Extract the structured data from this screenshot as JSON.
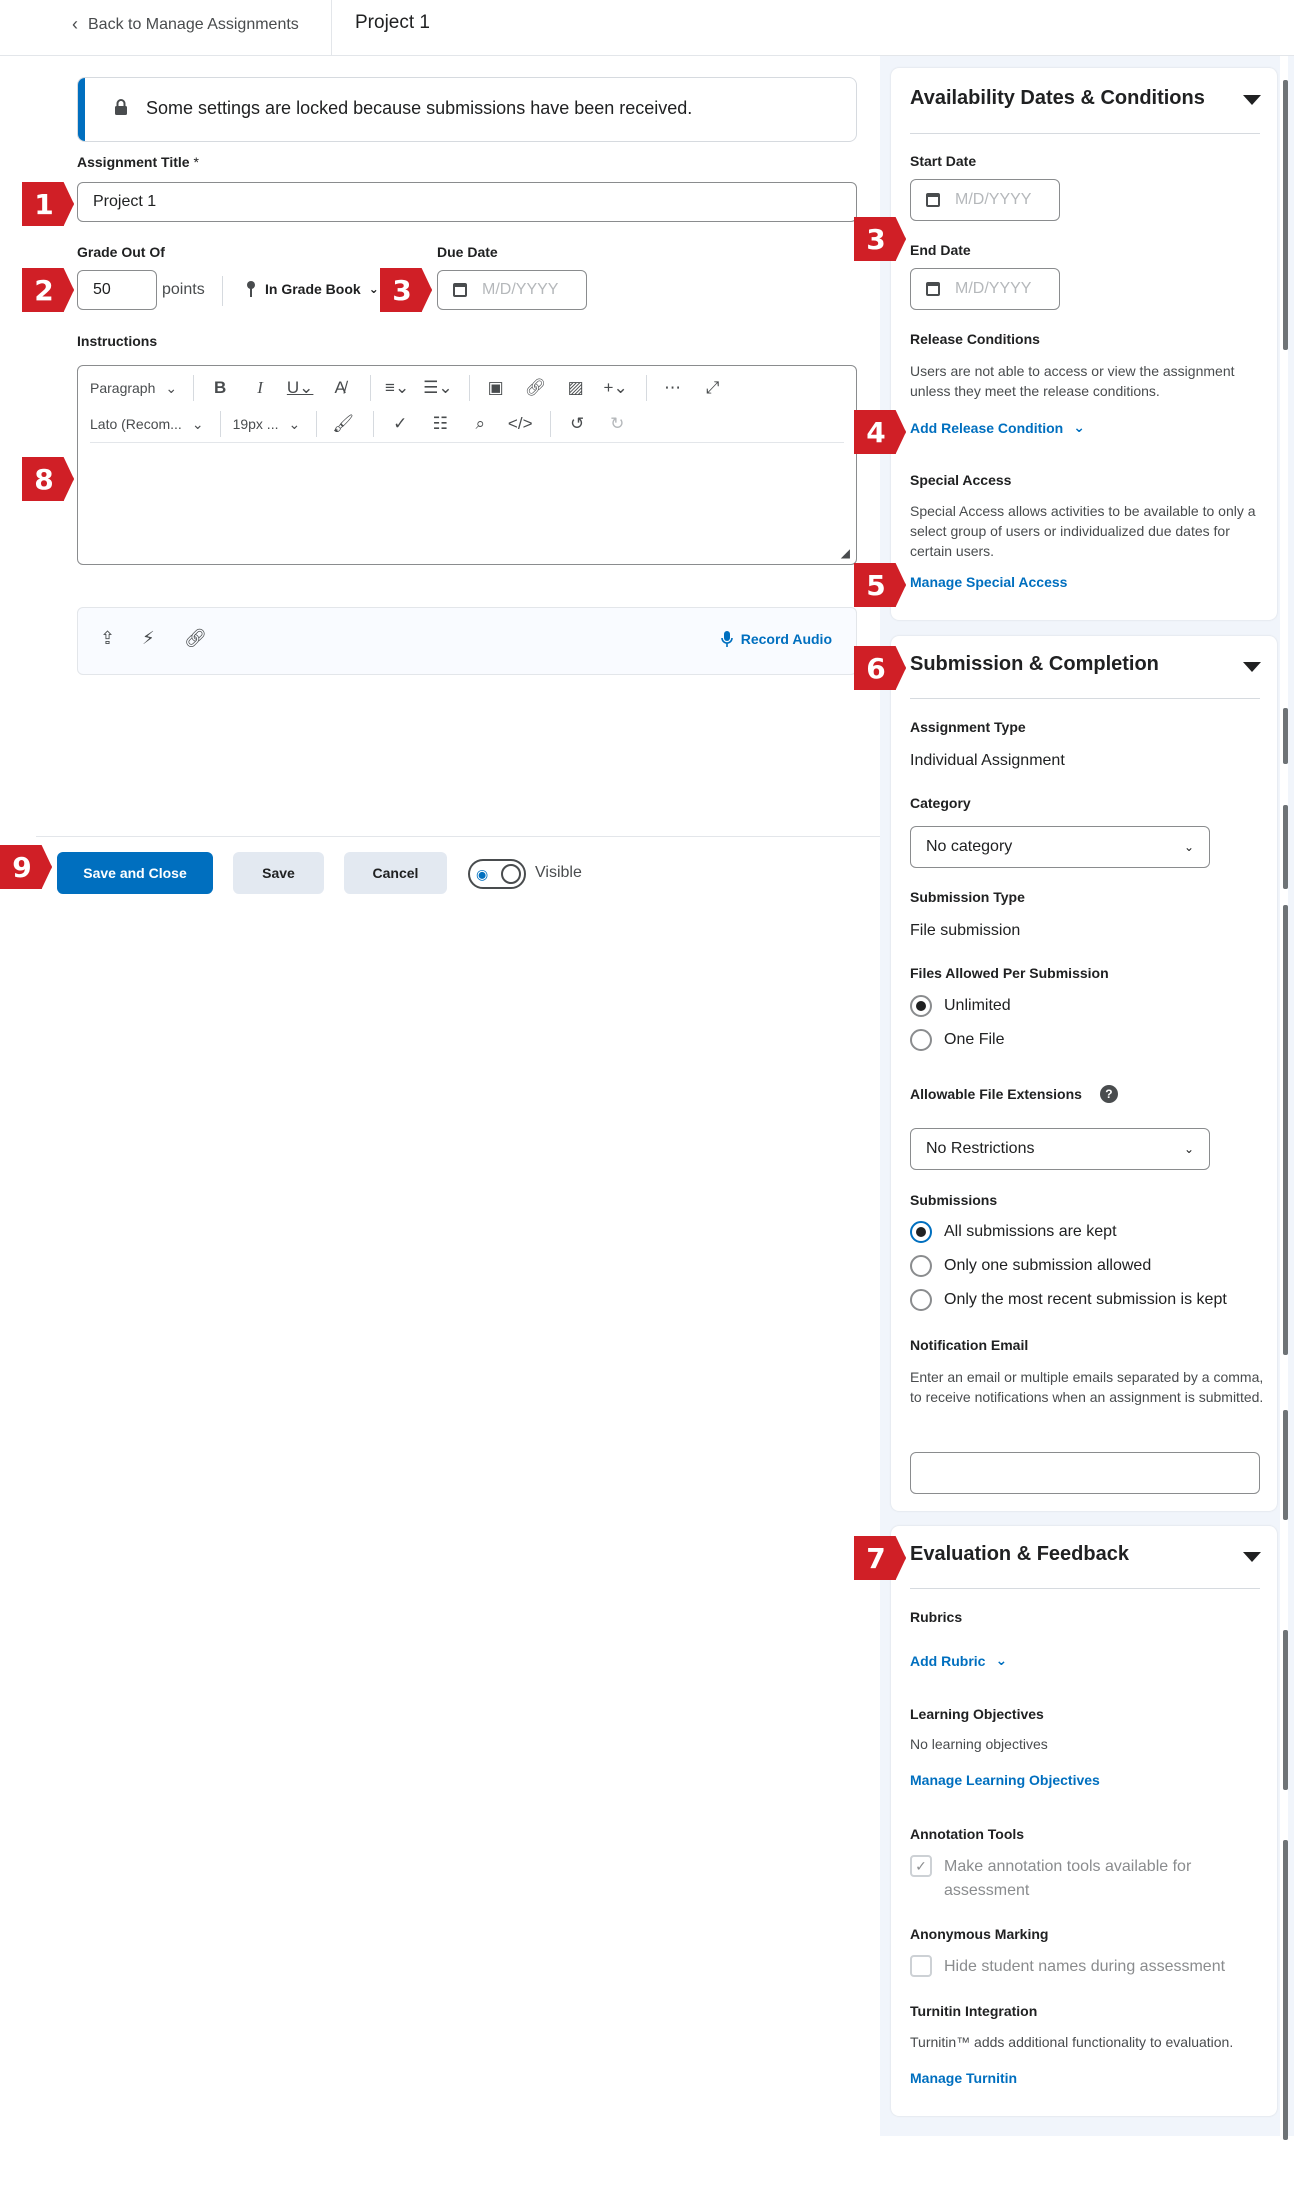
{
  "header": {
    "back_label": "Back to Manage Assignments",
    "page_title": "Project 1"
  },
  "alert": {
    "message": "Some settings are locked because submissions have been received."
  },
  "form": {
    "title_label": "Assignment Title",
    "title_required_mark": "*",
    "title_value": "Project 1",
    "grade_label": "Grade Out Of",
    "grade_value": "50",
    "grade_unit": "points",
    "gradebook_label": "In Grade Book",
    "due_label": "Due Date",
    "due_placeholder": "M/D/YYYY",
    "instructions_label": "Instructions"
  },
  "editor": {
    "format_label": "Paragraph",
    "font_label": "Lato (Recom...",
    "size_label": "19px ..."
  },
  "attachments": {
    "record_audio_label": "Record Audio"
  },
  "footer": {
    "save_close_label": "Save and Close",
    "save_label": "Save",
    "cancel_label": "Cancel",
    "visible_label": "Visible"
  },
  "availability": {
    "title": "Availability Dates & Conditions",
    "start_label": "Start Date",
    "start_placeholder": "M/D/YYYY",
    "end_label": "End Date",
    "end_placeholder": "M/D/YYYY",
    "release_label": "Release Conditions",
    "release_text": "Users are not able to access or view the assignment unless they meet the release conditions.",
    "add_release_label": "Add Release Condition",
    "special_label": "Special Access",
    "special_text": "Special Access allows activities to be available to only a select group of users or individualized due dates for certain users.",
    "manage_special_label": "Manage Special Access"
  },
  "submission": {
    "title": "Submission & Completion",
    "type_label": "Assignment Type",
    "type_value": "Individual Assignment",
    "category_label": "Category",
    "category_value": "No category",
    "submission_type_label": "Submission Type",
    "submission_type_value": "File submission",
    "files_allowed_label": "Files Allowed Per Submission",
    "files_options": [
      "Unlimited",
      "One File"
    ],
    "extensions_label": "Allowable File Extensions",
    "extensions_value": "No Restrictions",
    "submissions_label": "Submissions",
    "submissions_options": [
      "All submissions are kept",
      "Only one submission allowed",
      "Only the most recent submission is kept"
    ],
    "notification_label": "Notification Email",
    "notification_text": "Enter an email or multiple emails separated by a comma, to receive notifications when an assignment is submitted.",
    "notification_value": ""
  },
  "evaluation": {
    "title": "Evaluation & Feedback",
    "rubrics_label": "Rubrics",
    "add_rubric_label": "Add Rubric",
    "objectives_label": "Learning Objectives",
    "objectives_text": "No learning objectives",
    "manage_objectives_label": "Manage Learning Objectives",
    "annotation_label": "Annotation Tools",
    "annotation_text": "Make annotation tools available for assessment",
    "anonymous_label": "Anonymous Marking",
    "anonymous_text": "Hide student names during assessment",
    "turnitin_label": "Turnitin Integration",
    "turnitin_text": "Turnitin™ adds additional functionality to evaluation.",
    "manage_turnitin_label": "Manage Turnitin"
  },
  "badges": [
    "1",
    "2",
    "3",
    "3",
    "4",
    "5",
    "6",
    "7",
    "8",
    "9"
  ],
  "colors": {
    "primary": "#006fbf",
    "badge": "#d01f26",
    "panel_bg": "#f1f5fb"
  },
  "icons": [
    "chevron-left-icon",
    "lock-icon",
    "calendar-icon",
    "pin-icon",
    "microphone-icon",
    "upload-icon",
    "eye-icon",
    "help-icon",
    "check-icon"
  ]
}
